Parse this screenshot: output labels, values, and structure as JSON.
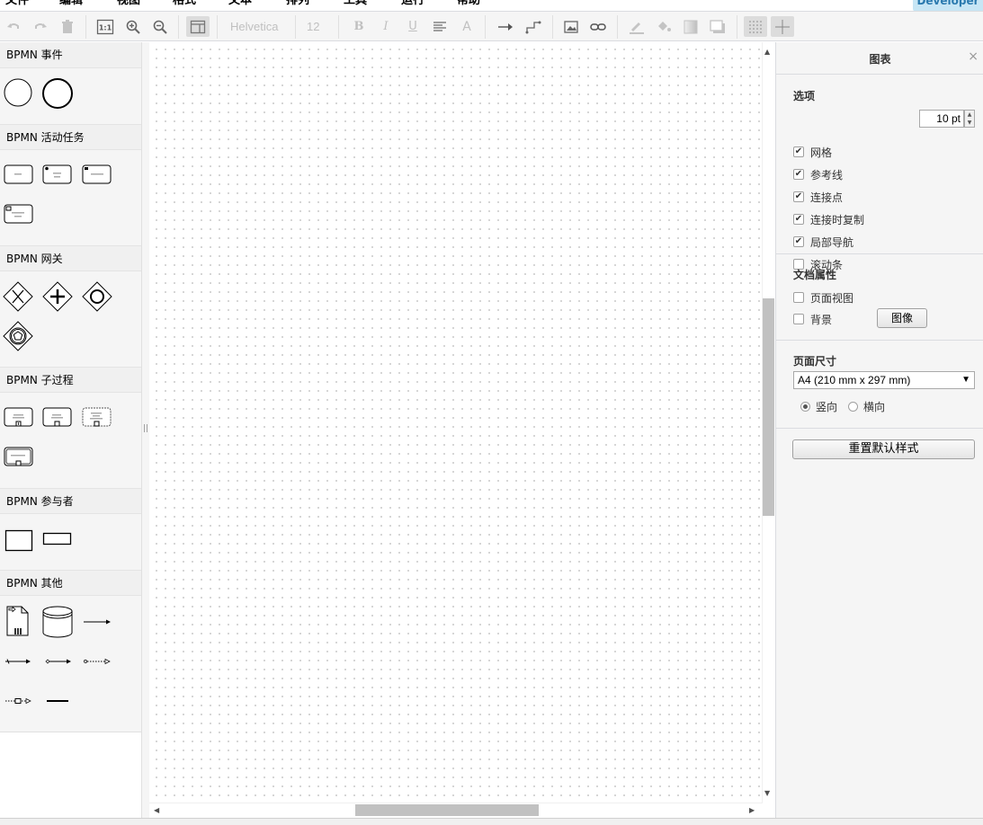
{
  "menubar": {
    "items": [
      "文件",
      "编辑",
      "视图",
      "格式",
      "文本",
      "排列",
      "工具",
      "运行",
      "帮助"
    ],
    "developer_badge": "Developer"
  },
  "toolbar": {
    "font_name": "Helvetica",
    "font_size": "12",
    "buttons": [
      "undo",
      "redo",
      "delete",
      "actual-size",
      "zoom-in",
      "zoom-out",
      "format-panel",
      "bold",
      "italic",
      "underline",
      "align",
      "font-color",
      "connection",
      "waypoints",
      "image",
      "link",
      "line-color",
      "fill-color",
      "gradient",
      "shadow",
      "grid",
      "guides"
    ]
  },
  "sidebar": {
    "sections": [
      {
        "title": "BPMN 事件"
      },
      {
        "title": "BPMN 活动任务"
      },
      {
        "title": "BPMN 网关"
      },
      {
        "title": "BPMN 子过程"
      },
      {
        "title": "BPMN 参与者"
      },
      {
        "title": "BPMN 其他"
      }
    ]
  },
  "panel": {
    "title": "图表",
    "close": "×",
    "options": {
      "title": "选项",
      "grid_label": "网格",
      "grid_size": "10 pt",
      "items": [
        {
          "label": "网格",
          "checked": true
        },
        {
          "label": "参考线",
          "checked": true
        },
        {
          "label": "连接点",
          "checked": true
        },
        {
          "label": "连接时复制",
          "checked": true
        },
        {
          "label": "局部导航",
          "checked": true
        },
        {
          "label": "滚动条",
          "checked": false
        }
      ]
    },
    "document": {
      "title": "文档属性",
      "page_view": {
        "label": "页面视图",
        "checked": false
      },
      "background": {
        "label": "背景",
        "checked": false
      },
      "image_button": "图像"
    },
    "page_size": {
      "title": "页面尺寸",
      "selected": "A4 (210 mm x 297 mm)",
      "portrait": "竖向",
      "landscape": "横向",
      "orientation": "portrait"
    },
    "reset_button": "重置默认样式"
  },
  "scroll": {
    "up": "▲",
    "down": "▼",
    "left": "◀",
    "right": "▶",
    "splitter": "||"
  }
}
